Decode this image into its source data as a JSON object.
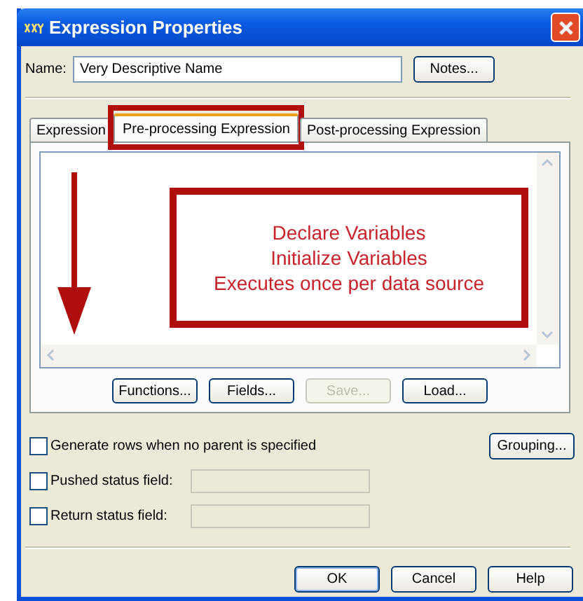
{
  "window": {
    "title": "Expression Properties"
  },
  "name_field": {
    "label": "Name:",
    "value": "Very Descriptive Name"
  },
  "notes_button": "Notes...",
  "tabs": [
    {
      "label": "Expression",
      "selected": false,
      "highlighted": false
    },
    {
      "label": "Pre-processing Expression",
      "selected": true,
      "highlighted": true
    },
    {
      "label": "Post-processing Expression",
      "selected": false,
      "highlighted": false
    }
  ],
  "annotation": {
    "lines": [
      "Declare Variables",
      "Initialize Variables",
      "Executes once per data source"
    ]
  },
  "editor_buttons": [
    {
      "label": "Functions...",
      "disabled": false
    },
    {
      "label": "Fields...",
      "disabled": false
    },
    {
      "label": "Save...",
      "disabled": true
    },
    {
      "label": "Load...",
      "disabled": false
    }
  ],
  "options": [
    {
      "kind": "checkbox",
      "label": "Generate rows when no parent is specified",
      "checked": false
    },
    {
      "kind": "checkbox-field",
      "label": "Pushed status field:",
      "checked": false
    },
    {
      "kind": "checkbox-field",
      "label": "Return status field:",
      "checked": false
    }
  ],
  "grouping_button": "Grouping...",
  "dialog_buttons": [
    "OK",
    "Cancel",
    "Help"
  ]
}
